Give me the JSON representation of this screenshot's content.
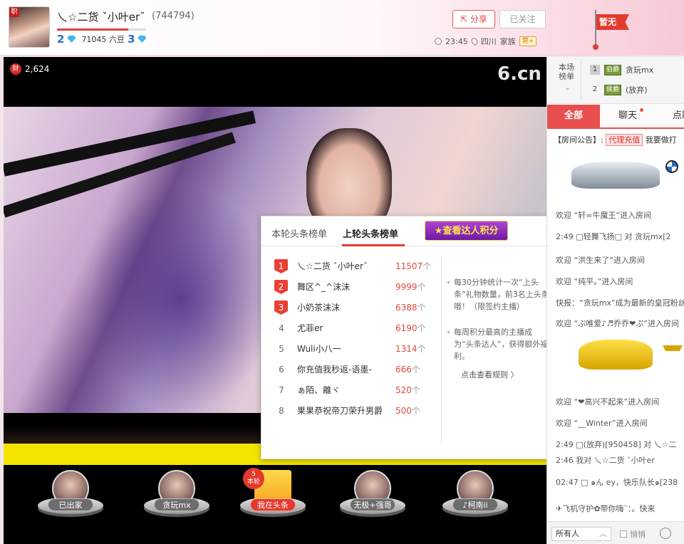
{
  "header": {
    "anchor_name": "乀☆二货 ˇ小叶er˘",
    "anchor_id": "(744794)",
    "level_left": "2",
    "beans": "71045 六豆",
    "level_right": "3",
    "level_progress": 0.8,
    "share_label": "分享",
    "follow_label": "已关注",
    "time": "23:45",
    "location": "四川",
    "family_label": "家族",
    "family_tag": "菀+",
    "flag_label": "暂无"
  },
  "video": {
    "wealth_icon": "财",
    "wealth_count": "2,624",
    "watermark": "6.cn"
  },
  "rankers": [
    {
      "name": "已出家"
    },
    {
      "name": "贪玩mx"
    },
    {
      "name": "我在头条",
      "badge_top": "5",
      "badge_bottom": "本轮"
    },
    {
      "name": "无极+强哥"
    },
    {
      "name": "♪柯南ii"
    }
  ],
  "popup": {
    "tab_current": "本轮头条榜单",
    "tab_last": "上轮头条榜单",
    "star_button": "查看达人积分",
    "close_icon": "×",
    "unit": "个",
    "rows": [
      {
        "rank": "1",
        "name": "乀☆二货 ˇ小叶er˘",
        "points": "11507"
      },
      {
        "rank": "2",
        "name": "舞区^_^沫沫",
        "points": "9999"
      },
      {
        "rank": "3",
        "name": "小奶茶沫沫",
        "points": "6388"
      },
      {
        "rank": "4",
        "name": "尤菲er",
        "points": "6190"
      },
      {
        "rank": "5",
        "name": "Wuli小八一",
        "points": "1314"
      },
      {
        "rank": "6",
        "name": "你充值我秒返-语墨-",
        "points": "666"
      },
      {
        "rank": "7",
        "name": "ぁ陌、離ヾ",
        "points": "520"
      },
      {
        "rank": "8",
        "name": "果果恭祝帝刀荣升男爵",
        "points": "500"
      }
    ],
    "note1": "每30分钟统计一次“上头条”礼物数量，前3名上头条哦！（限签约主播）",
    "note2": "每周积分最高的主播成为“头条达人”，获得额外福利。",
    "rule_link": "点击查看规则 〉"
  },
  "sidebar": {
    "board_title": "本场榜单",
    "board_rows": [
      {
        "rank": "1",
        "tag": "伯爵",
        "name": "贪玩mx"
      },
      {
        "rank": "2",
        "tag": "侯爵",
        "name": "(放弃)"
      }
    ],
    "tabs": [
      "全部",
      "聊天",
      "点歌"
    ],
    "notice_label": "【房间公告】:",
    "notice_tag": "代理充值",
    "notice_text": "我要做打",
    "chats": [
      "欢迎 “轩∞牛魔王”进入房间",
      "2:49 □轻舞飞扬□ 对 贪玩mx[2",
      "欢迎 “洪生来了”进入房间",
      "欢迎 “纯平。”进入房间",
      "快报：“贪玩mx”成为最新的皇冠粉丝",
      "欢迎 “ぷ唯爱♪♬乔乔❤ぷ”进入房间",
      "欢迎 “❤高兴不起来”进入房间",
      "欢迎 “__Winter”进入房间",
      "2:49 □(放弃)[950458] 对 乀☆二",
      "2:46 我对 乀☆二货 ˇ小叶er",
      "02:47 □ ๑ん ey，快乐队长๑[238",
      "✈飞机守护✿带你嗨˘：。快来"
    ],
    "select_label": "所有人",
    "quiet_label": "悄悄"
  }
}
